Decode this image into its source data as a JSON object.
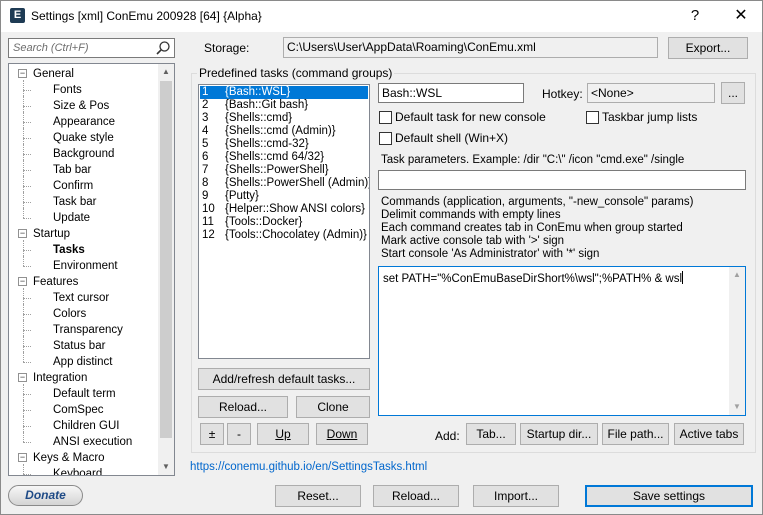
{
  "window": {
    "title": "Settings [xml] ConEmu 200928 [64] {Alpha}",
    "help_label": "?",
    "close_label": "✕"
  },
  "search": {
    "placeholder": "Search (Ctrl+F)"
  },
  "tree": [
    {
      "label": "General",
      "level": 0,
      "expanded": true
    },
    {
      "label": "Fonts",
      "level": 1
    },
    {
      "label": "Size & Pos",
      "level": 1
    },
    {
      "label": "Appearance",
      "level": 1
    },
    {
      "label": "Quake style",
      "level": 1
    },
    {
      "label": "Background",
      "level": 1
    },
    {
      "label": "Tab bar",
      "level": 1
    },
    {
      "label": "Confirm",
      "level": 1
    },
    {
      "label": "Task bar",
      "level": 1
    },
    {
      "label": "Update",
      "level": 1
    },
    {
      "label": "Startup",
      "level": 0,
      "expanded": true
    },
    {
      "label": "Tasks",
      "level": 1,
      "selected": true
    },
    {
      "label": "Environment",
      "level": 1
    },
    {
      "label": "Features",
      "level": 0,
      "expanded": true
    },
    {
      "label": "Text cursor",
      "level": 1
    },
    {
      "label": "Colors",
      "level": 1
    },
    {
      "label": "Transparency",
      "level": 1
    },
    {
      "label": "Status bar",
      "level": 1
    },
    {
      "label": "App distinct",
      "level": 1
    },
    {
      "label": "Integration",
      "level": 0,
      "expanded": true
    },
    {
      "label": "Default term",
      "level": 1
    },
    {
      "label": "ComSpec",
      "level": 1
    },
    {
      "label": "Children GUI",
      "level": 1
    },
    {
      "label": "ANSI execution",
      "level": 1
    },
    {
      "label": "Keys & Macro",
      "level": 0,
      "expanded": true
    },
    {
      "label": "Keyboard",
      "level": 1
    }
  ],
  "storage": {
    "label": "Storage:",
    "path": "C:\\Users\\User\\AppData\\Roaming\\ConEmu.xml",
    "export_label": "Export..."
  },
  "tasks_group": {
    "label": "Predefined tasks (command groups)",
    "items": [
      {
        "num": "1",
        "name": "{Bash::WSL}",
        "selected": true
      },
      {
        "num": "2",
        "name": "{Bash::Git bash}"
      },
      {
        "num": "3",
        "name": "{Shells::cmd}"
      },
      {
        "num": "4",
        "name": "{Shells::cmd (Admin)}"
      },
      {
        "num": "5",
        "name": "{Shells::cmd-32}"
      },
      {
        "num": "6",
        "name": "{Shells::cmd 64/32}"
      },
      {
        "num": "7",
        "name": "{Shells::PowerShell}"
      },
      {
        "num": "8",
        "name": "{Shells::PowerShell (Admin)}"
      },
      {
        "num": "9",
        "name": "{Putty}"
      },
      {
        "num": "10",
        "name": "{Helper::Show ANSI colors}"
      },
      {
        "num": "11",
        "name": "{Tools::Docker}"
      },
      {
        "num": "12",
        "name": "{Tools::Chocolatey (Admin)}"
      }
    ],
    "add_refresh_label": "Add/refresh default tasks...",
    "reload_label": "Reload...",
    "clone_label": "Clone",
    "plus_label": "±",
    "minus_label": "-",
    "up_label": "Up",
    "down_label": "Down"
  },
  "task_detail": {
    "name_value": "Bash::WSL",
    "hotkey_label": "Hotkey:",
    "hotkey_value": "<None>",
    "hotkey_more_label": "...",
    "default_task_label": "Default task for new console",
    "default_task_checked": false,
    "taskbar_jump_label": "Taskbar jump lists",
    "taskbar_jump_checked": false,
    "default_shell_label": "Default shell (Win+X)",
    "default_shell_checked": false,
    "params_label": "Task parameters. Example: /dir \"C:\\\" /icon \"cmd.exe\" /single",
    "params_value": "",
    "commands_help": [
      "Commands (application, arguments, \"-new_console\" params)",
      "Delimit commands with empty lines",
      "Each command creates tab in ConEmu when group started",
      "Mark active console tab with '>' sign",
      "Start console 'As Administrator' with '*' sign"
    ],
    "commands_value": "set PATH=\"%ConEmuBaseDirShort%\\wsl\";%PATH% & wsl",
    "add_label": "Add:",
    "tab_btn": "Tab...",
    "startup_dir_btn": "Startup dir...",
    "file_path_btn": "File path...",
    "active_tabs_btn": "Active tabs"
  },
  "footer": {
    "link": "https://conemu.github.io/en/SettingsTasks.html",
    "donate_label": "Donate",
    "reset_label": "Reset...",
    "reload_label": "Reload...",
    "import_label": "Import...",
    "save_label": "Save settings"
  },
  "colors": {
    "selection": "#0078d7",
    "link": "#0066cc",
    "window_bg": "#f0f0f0"
  }
}
